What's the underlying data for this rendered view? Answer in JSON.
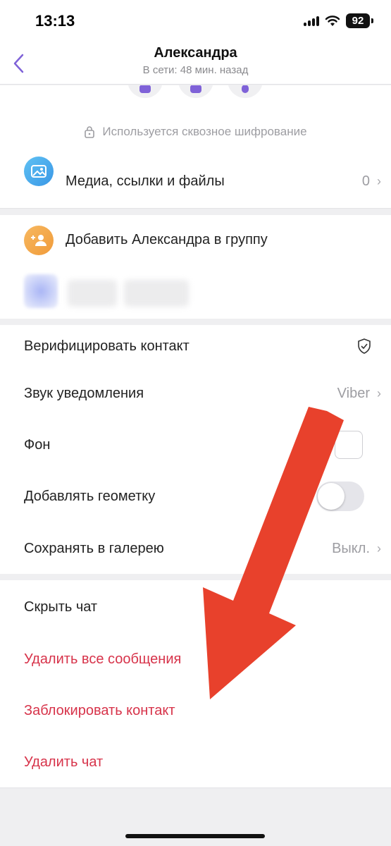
{
  "status": {
    "time": "13:13",
    "battery": "92"
  },
  "header": {
    "title": "Александра",
    "subtitle": "В сети: 48 мин. назад"
  },
  "encryption_note": "Используется сквозное шифрование",
  "media": {
    "label": "Медиа, ссылки и файлы",
    "count": "0"
  },
  "group": {
    "add_label": "Добавить Александра в группу"
  },
  "settings": {
    "verify": "Верифицировать контакт",
    "sound": {
      "label": "Звук уведомления",
      "value": "Viber"
    },
    "background": "Фон",
    "geotag": {
      "label": "Добавлять геометку",
      "enabled": false
    },
    "save_gallery": {
      "label": "Сохранять в галерею",
      "value": "Выкл."
    }
  },
  "actions": {
    "hide": "Скрыть чат",
    "delete_messages": "Удалить все сообщения",
    "block": "Заблокировать контакт",
    "delete_chat": "Удалить чат"
  },
  "colors": {
    "accent": "#7f62d8",
    "danger": "#d7334a",
    "annotation_arrow": "#e8412c"
  }
}
